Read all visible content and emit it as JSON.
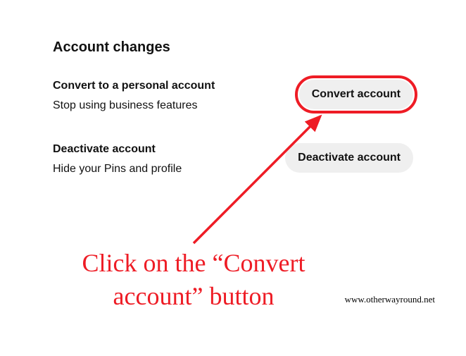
{
  "heading": "Account changes",
  "convert": {
    "title": "Convert to a personal account",
    "desc": "Stop using business features",
    "button": "Convert account"
  },
  "deactivate": {
    "title": "Deactivate account",
    "desc": "Hide your Pins and profile",
    "button": "Deactivate account"
  },
  "annotation": {
    "text": "Click on the “Convert account” button"
  },
  "watermark": "www.otherwayround.net"
}
